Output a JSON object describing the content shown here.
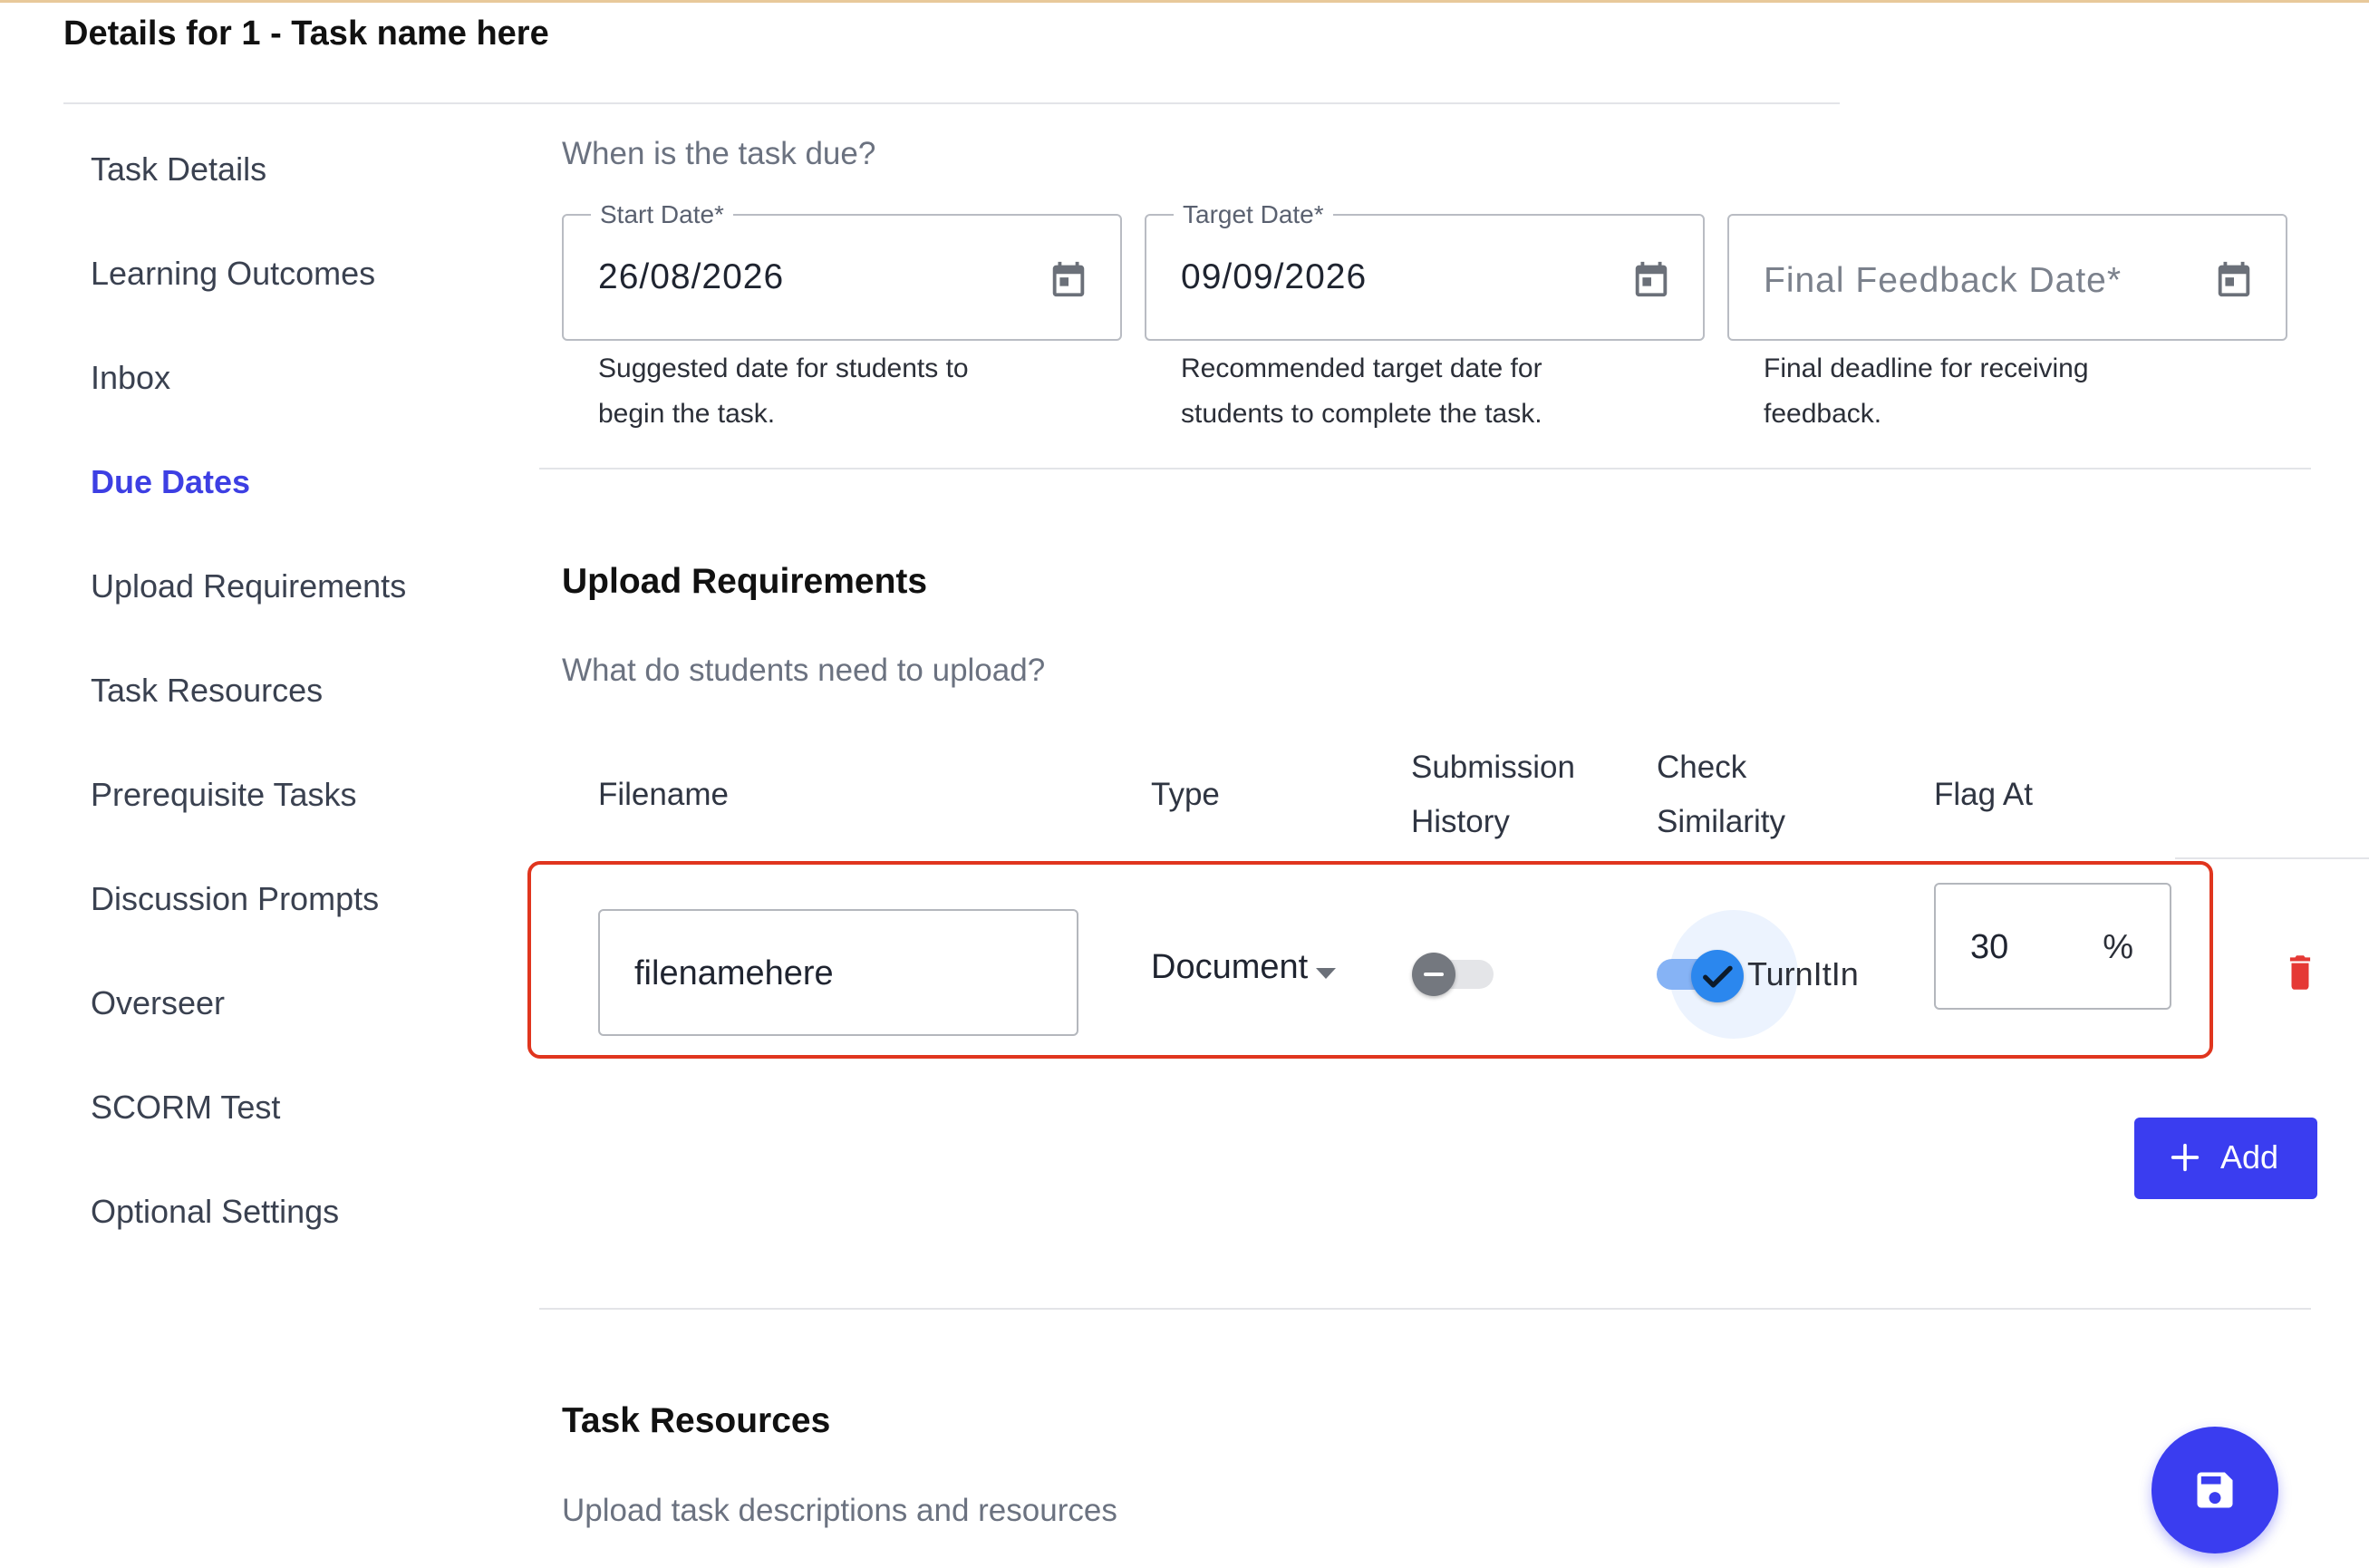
{
  "page_title": "Details for 1 - Task name here",
  "sidebar": {
    "items": [
      {
        "label": "Task Details"
      },
      {
        "label": "Learning Outcomes"
      },
      {
        "label": "Inbox"
      },
      {
        "label": "Due Dates",
        "active": true
      },
      {
        "label": "Upload Requirements"
      },
      {
        "label": "Task Resources"
      },
      {
        "label": "Prerequisite Tasks"
      },
      {
        "label": "Discussion Prompts"
      },
      {
        "label": "Overseer"
      },
      {
        "label": "SCORM Test"
      },
      {
        "label": "Optional Settings"
      }
    ]
  },
  "due_dates": {
    "question": "When is the task due?",
    "start": {
      "label": "Start Date*",
      "value": "26/08/2026",
      "helper": "Suggested date for students to begin the task."
    },
    "target": {
      "label": "Target Date*",
      "value": "09/09/2026",
      "helper": "Recommended target date for students to complete the task."
    },
    "feedback": {
      "placeholder": "Final Feedback Date*",
      "value": "",
      "helper": "Final deadline for receiving feedback."
    }
  },
  "upload_requirements": {
    "title": "Upload Requirements",
    "question": "What do students need to upload?",
    "columns": {
      "filename": "Filename",
      "type": "Type",
      "submission_history_1": "Submission",
      "submission_history_2": "History",
      "check_similarity_1": "Check",
      "check_similarity_2": "Similarity",
      "flag_at": "Flag At"
    },
    "rows": [
      {
        "filename": "filenamehere",
        "type": "Document",
        "submission_history": false,
        "check_similarity": true,
        "check_label": "TurnItIn",
        "flag_at": "30",
        "flag_suffix": "%"
      }
    ],
    "add_label": "Add"
  },
  "task_resources": {
    "title": "Task Resources",
    "question": "Upload task descriptions and resources"
  },
  "colors": {
    "accent": "#3a3df0",
    "active_nav": "#3d3fe3",
    "highlight_outline": "#e0351e",
    "delete": "#e53935",
    "toggle_on": "#2b87ee"
  },
  "icons": {
    "calendar": "calendar-icon",
    "delete": "trash-icon",
    "add": "plus-icon",
    "save": "save-icon"
  }
}
